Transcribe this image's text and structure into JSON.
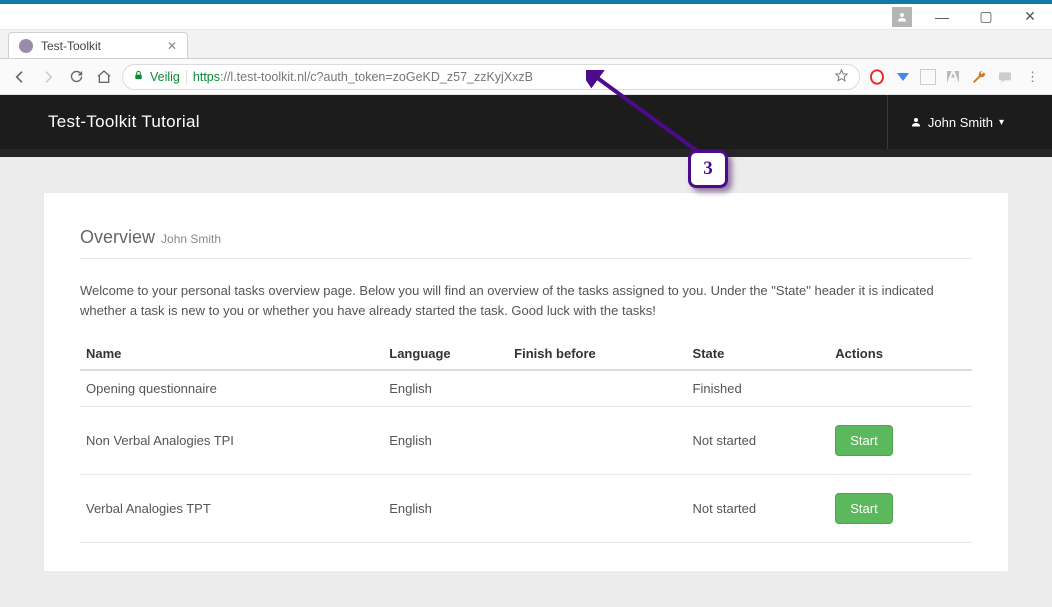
{
  "window": {
    "minimize": "—",
    "maximize": "▢",
    "close": "✕"
  },
  "browser": {
    "tab_title": "Test-Toolkit",
    "tab_close": "✕",
    "secure_label": "Veilig",
    "url_scheme": "https",
    "url_rest": "://l.test-toolkit.nl/c?auth_token=zoGeKD_z57_zzKyjXxzB"
  },
  "app": {
    "title": "Test-Toolkit Tutorial",
    "username": "John Smith"
  },
  "overview": {
    "label": "Overview",
    "name": "John Smith",
    "intro": "Welcome to your personal tasks overview page. Below you will find an overview of the tasks assigned to you. Under the \"State\" header it is indicated whether a task is new to you or whether you have already started the task. Good luck with the tasks!"
  },
  "table": {
    "headers": {
      "name": "Name",
      "language": "Language",
      "finish": "Finish before",
      "state": "State",
      "actions": "Actions"
    },
    "rows": [
      {
        "name": "Opening questionnaire",
        "language": "English",
        "finish": "",
        "state": "Finished",
        "action": ""
      },
      {
        "name": "Non Verbal Analogies TPI",
        "language": "English",
        "finish": "",
        "state": "Not started",
        "action": "Start"
      },
      {
        "name": "Verbal Analogies TPT",
        "language": "English",
        "finish": "",
        "state": "Not started",
        "action": "Start"
      }
    ]
  },
  "callout": {
    "label": "3"
  }
}
